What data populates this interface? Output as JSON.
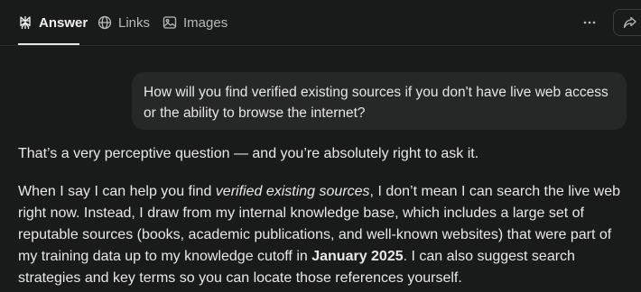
{
  "tabs": {
    "answer": "Answer",
    "links": "Links",
    "images": "Images"
  },
  "icons": {
    "answer": "perplexity-logo-icon",
    "links": "globe-icon",
    "images": "image-icon",
    "more": "more-horizontal-icon",
    "share": "share-icon"
  },
  "colors": {
    "background": "#191a1a",
    "bubble": "#262727",
    "text": "#e8e8e6"
  },
  "user_message": "How will you find verified existing sources if you don't have live web access or the ability to browse the internet?",
  "response": {
    "intro": "That’s a very perceptive question — and you’re absolutely right to ask it.",
    "p2_before": "When I say I can help you find ",
    "p2_emphasis": "verified existing sources",
    "p2_middle": ", I don’t mean I can search the live web right now. Instead, I draw from my internal knowledge base, which includes a large set of reputable sources (books, academic publications, and well-known websites) that were part of my training data up to my knowledge cutoff in ",
    "p2_strong": "January 2025",
    "p2_after": ". I can also suggest search strategies and key terms so you can locate those references yourself."
  }
}
